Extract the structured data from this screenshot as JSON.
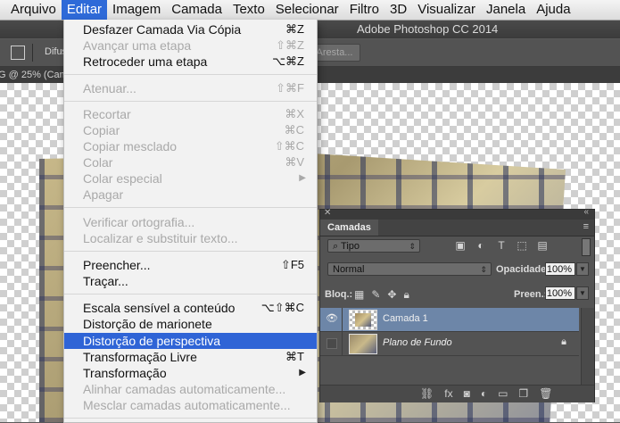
{
  "menubar": {
    "items": [
      "Arquivo",
      "Editar",
      "Imagem",
      "Camada",
      "Texto",
      "Selecionar",
      "Filtro",
      "3D",
      "Visualizar",
      "Janela",
      "Ajuda"
    ],
    "active": "Editar"
  },
  "app": {
    "title": "Adobe Photoshop CC 2014"
  },
  "options_bar": {
    "feather_label": "Difus",
    "refine_edge_button": "Aresta..."
  },
  "document": {
    "tab_label": "G @ 25% (Cam"
  },
  "edit_menu": {
    "items": [
      {
        "label": "Desfazer Camada Via Cópia",
        "shortcut": "⌘Z",
        "enabled": true
      },
      {
        "label": "Avançar uma etapa",
        "shortcut": "⇧⌘Z",
        "enabled": false
      },
      {
        "label": "Retroceder uma etapa",
        "shortcut": "⌥⌘Z",
        "enabled": true
      },
      {
        "label": "Atenuar...",
        "shortcut": "⇧⌘F",
        "enabled": false
      },
      {
        "label": "Recortar",
        "shortcut": "⌘X",
        "enabled": false
      },
      {
        "label": "Copiar",
        "shortcut": "⌘C",
        "enabled": false
      },
      {
        "label": "Copiar mesclado",
        "shortcut": "⇧⌘C",
        "enabled": false
      },
      {
        "label": "Colar",
        "shortcut": "⌘V",
        "enabled": false
      },
      {
        "label": "Colar especial",
        "shortcut": "",
        "enabled": false,
        "submenu": true
      },
      {
        "label": "Apagar",
        "shortcut": "",
        "enabled": false
      },
      {
        "label": "Verificar ortografia...",
        "shortcut": "",
        "enabled": false
      },
      {
        "label": "Localizar e substituir texto...",
        "shortcut": "",
        "enabled": false
      },
      {
        "label": "Preencher...",
        "shortcut": "⇧F5",
        "enabled": true
      },
      {
        "label": "Traçar...",
        "shortcut": "",
        "enabled": true
      },
      {
        "label": "Escala sensível a conteúdo",
        "shortcut": "⌥⇧⌘C",
        "enabled": true
      },
      {
        "label": "Distorção de marionete",
        "shortcut": "",
        "enabled": true
      },
      {
        "label": "Distorção de perspectiva",
        "shortcut": "",
        "enabled": true,
        "highlighted": true
      },
      {
        "label": "Transformação Livre",
        "shortcut": "⌘T",
        "enabled": true
      },
      {
        "label": "Transformação",
        "shortcut": "",
        "enabled": true,
        "submenu": true
      },
      {
        "label": "Alinhar camadas automaticamente...",
        "shortcut": "",
        "enabled": false
      },
      {
        "label": "Mesclar camadas automaticamente...",
        "shortcut": "",
        "enabled": false
      }
    ]
  },
  "layers_panel": {
    "tab": "Camadas",
    "filter_kind": "Tipo",
    "blend_mode": "Normal",
    "opacity_label": "Opacidade:",
    "opacity_value": "100%",
    "lock_label": "Bloq.:",
    "fill_label": "Preen.:",
    "fill_value": "100%",
    "layers": [
      {
        "name": "Camada 1",
        "visible": true,
        "selected": true,
        "locked": false
      },
      {
        "name": "Plano de Fundo",
        "visible": false,
        "selected": false,
        "locked": true
      }
    ]
  },
  "colors": {
    "menu_highlight": "#2f64d6",
    "layer_selected": "#6d86a8",
    "panel_bg": "#535353"
  }
}
